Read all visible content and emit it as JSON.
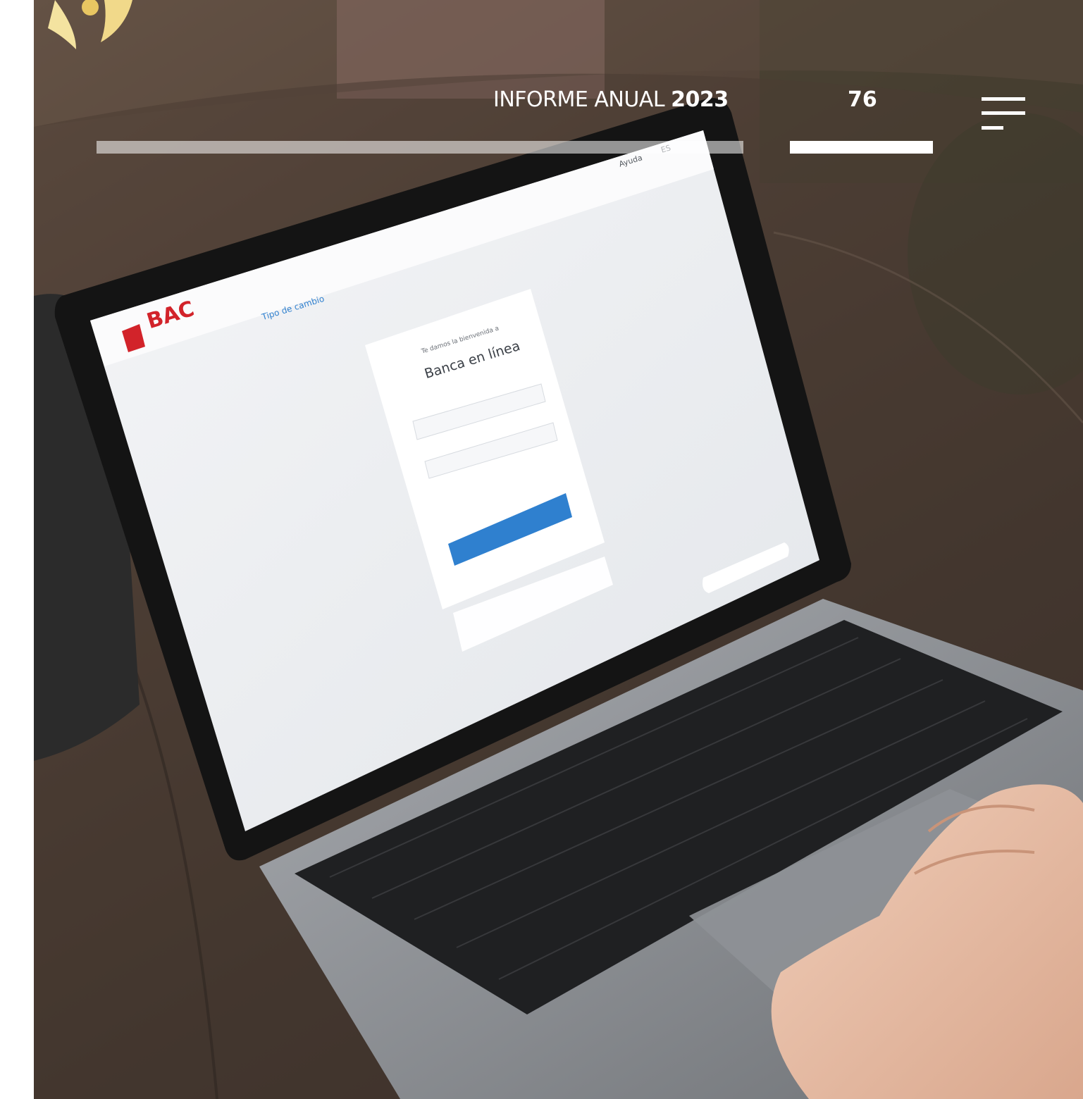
{
  "header": {
    "title_prefix": "INFORME ANUAL",
    "title_year": "2023",
    "page_number": "76"
  },
  "screen": {
    "brand": "BAC",
    "nav_dropdown": "Tipo de cambio",
    "help_link": "Ayuda",
    "language": "ES",
    "login_greeting": "Te damos la bienvenida a",
    "login_title": "Banca en línea"
  },
  "colors": {
    "brand_red": "#d2232a",
    "login_blue": "#2f80cf",
    "header_text": "#ffffff"
  },
  "icons": {
    "menu": "hamburger-menu-icon"
  }
}
